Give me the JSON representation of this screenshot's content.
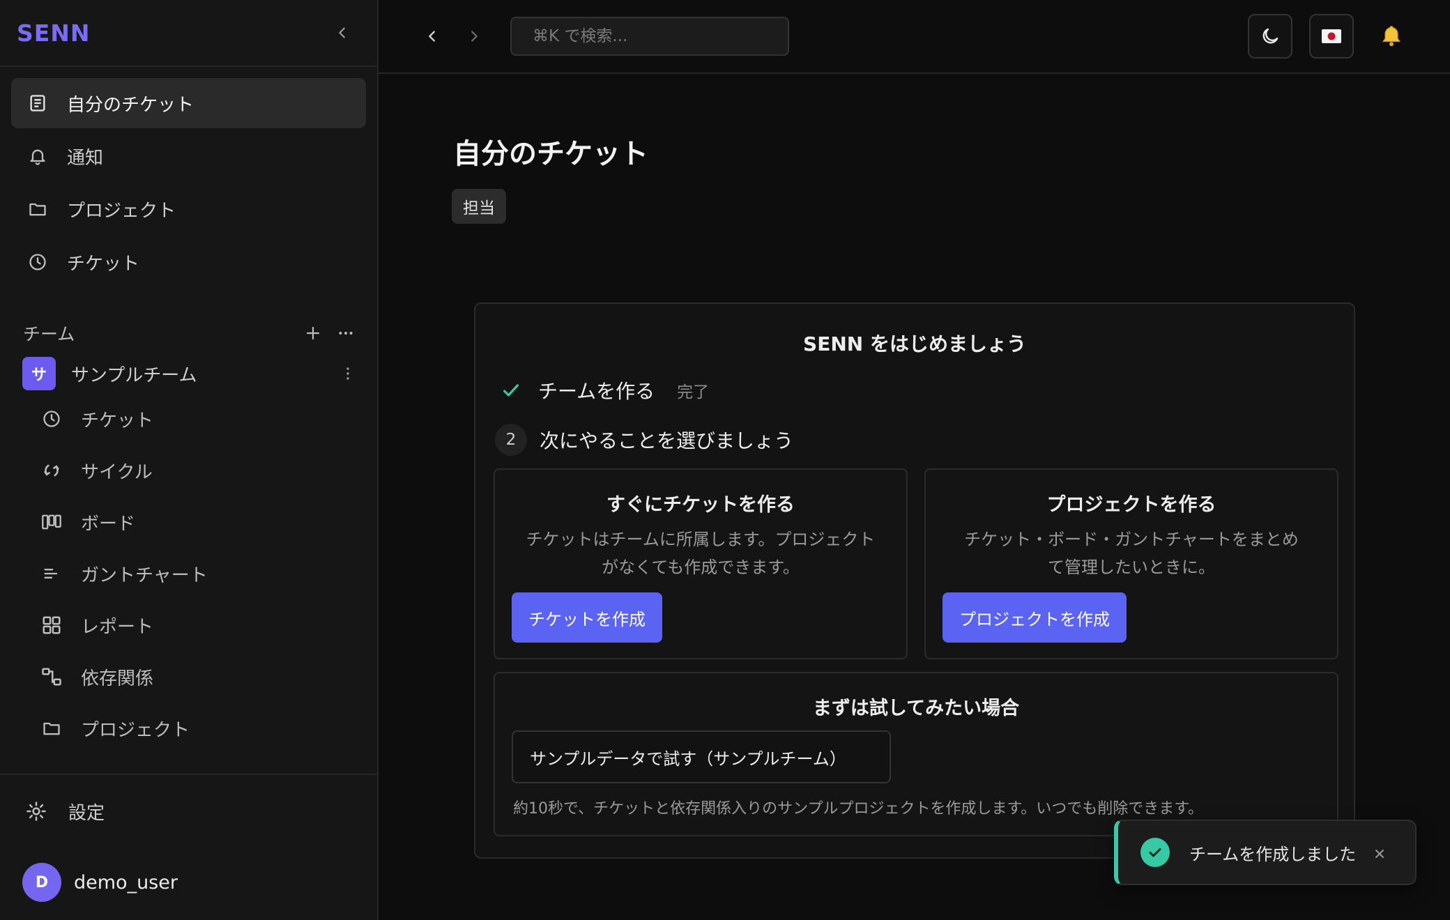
{
  "sidebar": {
    "brand": "SENN",
    "collapse_icon": "chevron-left-icon",
    "nav": [
      {
        "label": "自分のチケット",
        "icon": "document-icon",
        "active": true
      },
      {
        "label": "通知",
        "icon": "bell-icon",
        "active": false
      },
      {
        "label": "プロジェクト",
        "icon": "folder-icon",
        "active": false
      },
      {
        "label": "チケット",
        "icon": "clock-icon",
        "active": false
      }
    ],
    "team_section": {
      "label": "チーム",
      "add_icon": "plus-icon",
      "more_icon": "ellipsis-icon"
    },
    "team": {
      "avatar_letter": "サ",
      "name": "サンプルチーム",
      "menu_icon": "vertical-ellipsis-icon",
      "items": [
        {
          "label": "チケット",
          "icon": "clock-icon"
        },
        {
          "label": "サイクル",
          "icon": "cycle-icon"
        },
        {
          "label": "ボード",
          "icon": "board-icon"
        },
        {
          "label": "ガントチャート",
          "icon": "gantt-icon"
        },
        {
          "label": "レポート",
          "icon": "grid-icon"
        },
        {
          "label": "依存関係",
          "icon": "dependency-icon"
        },
        {
          "label": "プロジェクト",
          "icon": "folder-icon"
        }
      ]
    },
    "settings_label": "設定",
    "user": {
      "avatar_letter": "D",
      "name": "demo_user"
    }
  },
  "topbar": {
    "search_placeholder": "⌘K で検索...",
    "theme_icon": "moon-icon",
    "language_icon": "japan-flag-icon",
    "notification_icon": "bell-icon"
  },
  "main": {
    "title": "自分のチケット",
    "filter_chip": "担当"
  },
  "onboarding": {
    "title": "SENN をはじめましょう",
    "step1": {
      "label": "チームを作る",
      "status": "完了"
    },
    "step2": {
      "number": "2",
      "label": "次にやることを選びましょう"
    },
    "cards": [
      {
        "title": "すぐにチケットを作る",
        "desc_line1": "チケットはチームに所属します。プロジェクト",
        "desc_line2": "がなくても作成できます。",
        "button": "チケットを作成"
      },
      {
        "title": "プロジェクトを作る",
        "desc_line1": "チケット・ボード・ガントチャートをまとめ",
        "desc_line2": "て管理したいときに。",
        "button": "プロジェクトを作成"
      }
    ],
    "trial": {
      "title": "まずは試してみたい場合",
      "button": "サンプルデータで試す（サンプルチーム）",
      "note": "約10秒で、チケットと依存関係入りのサンプルプロジェクトを作成します。いつでも削除できます。"
    }
  },
  "toast": {
    "message": "チームを作成しました",
    "close_icon": "close-icon"
  },
  "colors": {
    "accent": "#7b6cf6",
    "primary_button": "#5b63f2",
    "success": "#37c9a3"
  }
}
